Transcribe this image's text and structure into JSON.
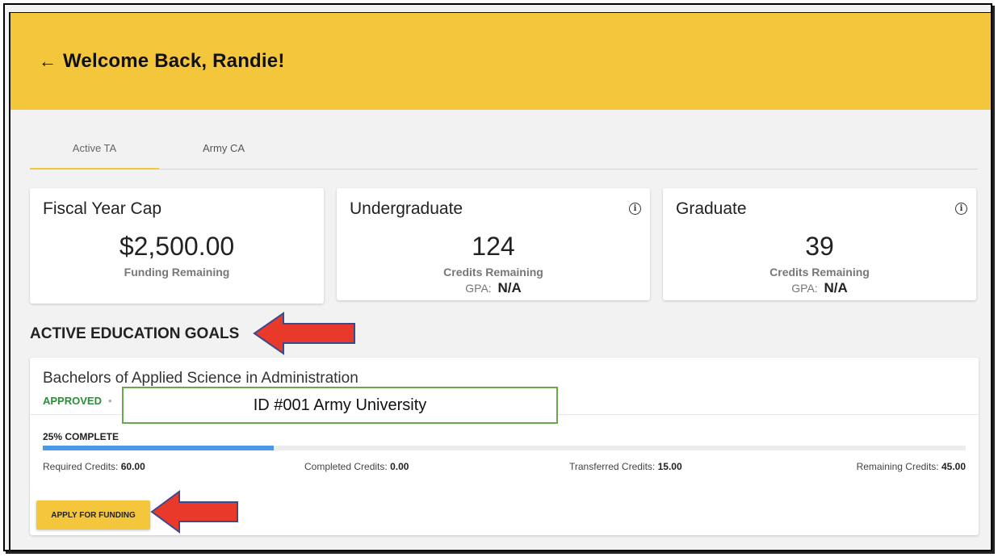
{
  "header": {
    "back_icon": "←",
    "title": "Welcome Back, Randie!"
  },
  "tabs": [
    {
      "label": "Active TA",
      "active": true
    },
    {
      "label": "Army CA",
      "active": false
    }
  ],
  "cards": {
    "fiscal": {
      "title": "Fiscal Year Cap",
      "value": "$2,500.00",
      "label": "Funding Remaining"
    },
    "undergrad": {
      "title": "Undergraduate",
      "value": "124",
      "label": "Credits Remaining",
      "gpa_label": "GPA:",
      "gpa_value": "N/A"
    },
    "graduate": {
      "title": "Graduate",
      "value": "39",
      "label": "Credits Remaining",
      "gpa_label": "GPA:",
      "gpa_value": "N/A"
    }
  },
  "section_title": "ACTIVE EDUCATION GOALS",
  "goal": {
    "name": "Bachelors of Applied Science in Administration",
    "status": "APPROVED",
    "id_overlay": "ID #001 Army University",
    "progress_label": "25% COMPLETE",
    "progress_percent": 25,
    "credits": {
      "required_label": "Required Credits:",
      "required": "60.00",
      "completed_label": "Completed Credits:",
      "completed": "0.00",
      "transferred_label": "Transferred Credits:",
      "transferred": "15.00",
      "remaining_label": "Remaining Credits:",
      "remaining": "45.00"
    },
    "apply_button": "APPLY FOR FUNDING"
  },
  "colors": {
    "header": "#f3c63c",
    "progress": "#4a98e8",
    "approved": "#2e8b3a",
    "arrow_fill": "#e8392a",
    "arrow_stroke": "#3b4a8a",
    "id_border": "#6aa84f"
  },
  "icons": [
    "back-arrow-icon",
    "info-icon",
    "annotation-arrow-icon"
  ]
}
